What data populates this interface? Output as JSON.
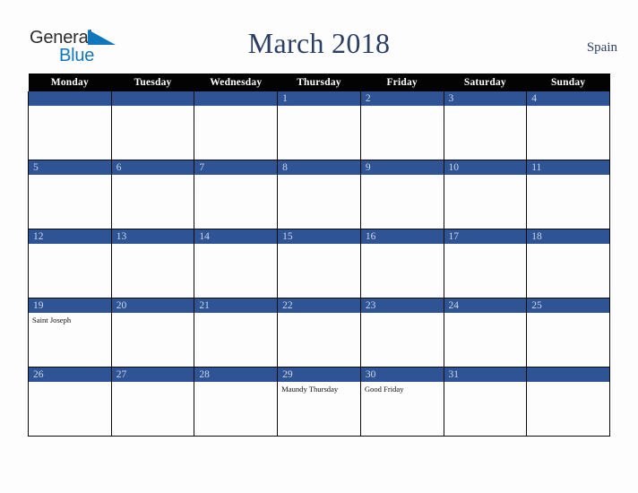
{
  "brand": {
    "name_part1": "General",
    "name_part2": "Blue",
    "triangle_icon": "triangle-icon",
    "blue_hex": "#1077bd",
    "dark_hex": "#2b2b2b"
  },
  "header": {
    "title": "March 2018",
    "country": "Spain",
    "title_color": "#2b3f63"
  },
  "calendar": {
    "weekday_headers": [
      "Monday",
      "Tuesday",
      "Wednesday",
      "Thursday",
      "Friday",
      "Saturday",
      "Sunday"
    ],
    "header_bg": "#030303",
    "daynum_bg": "#2e5496",
    "daynum_color": "#ccd6e8",
    "weeks": [
      [
        {
          "day": "",
          "events": []
        },
        {
          "day": "",
          "events": []
        },
        {
          "day": "",
          "events": []
        },
        {
          "day": "1",
          "events": []
        },
        {
          "day": "2",
          "events": []
        },
        {
          "day": "3",
          "events": []
        },
        {
          "day": "4",
          "events": []
        }
      ],
      [
        {
          "day": "5",
          "events": []
        },
        {
          "day": "6",
          "events": []
        },
        {
          "day": "7",
          "events": []
        },
        {
          "day": "8",
          "events": []
        },
        {
          "day": "9",
          "events": []
        },
        {
          "day": "10",
          "events": []
        },
        {
          "day": "11",
          "events": []
        }
      ],
      [
        {
          "day": "12",
          "events": []
        },
        {
          "day": "13",
          "events": []
        },
        {
          "day": "14",
          "events": []
        },
        {
          "day": "15",
          "events": []
        },
        {
          "day": "16",
          "events": []
        },
        {
          "day": "17",
          "events": []
        },
        {
          "day": "18",
          "events": []
        }
      ],
      [
        {
          "day": "19",
          "events": [
            "Saint Joseph"
          ]
        },
        {
          "day": "20",
          "events": []
        },
        {
          "day": "21",
          "events": []
        },
        {
          "day": "22",
          "events": []
        },
        {
          "day": "23",
          "events": []
        },
        {
          "day": "24",
          "events": []
        },
        {
          "day": "25",
          "events": []
        }
      ],
      [
        {
          "day": "26",
          "events": []
        },
        {
          "day": "27",
          "events": []
        },
        {
          "day": "28",
          "events": []
        },
        {
          "day": "29",
          "events": [
            "Maundy Thursday"
          ]
        },
        {
          "day": "30",
          "events": [
            "Good Friday"
          ]
        },
        {
          "day": "31",
          "events": []
        },
        {
          "day": "",
          "events": []
        }
      ]
    ]
  }
}
